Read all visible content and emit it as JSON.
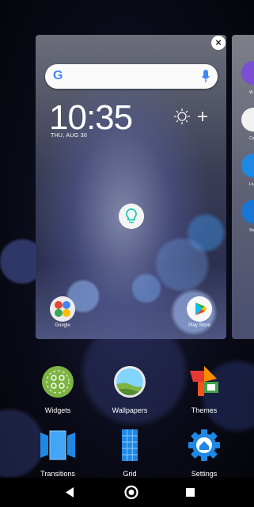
{
  "preview": {
    "clock": "10:35",
    "date": "THU, AUG 30",
    "dock": [
      {
        "label": "Google"
      },
      {
        "label": "Play Store"
      }
    ]
  },
  "peek": {
    "labels": [
      "W",
      "Co",
      "Lo",
      "Se"
    ]
  },
  "menu": {
    "items": [
      {
        "label": "Widgets",
        "icon": "widgets-icon"
      },
      {
        "label": "Wallpapers",
        "icon": "wallpapers-icon"
      },
      {
        "label": "Themes",
        "icon": "themes-icon"
      },
      {
        "label": "Transitions",
        "icon": "transitions-icon"
      },
      {
        "label": "Grid",
        "icon": "grid-icon"
      },
      {
        "label": "Settings",
        "icon": "settings-icon"
      }
    ]
  },
  "navbar": {
    "buttons": [
      "back-icon",
      "home-icon",
      "recents-icon"
    ]
  },
  "colors": {
    "themes_red": "#E53935",
    "themes_green": "#43A047",
    "themes_orange": "#FB8C00",
    "blue": "#1E88E5"
  }
}
